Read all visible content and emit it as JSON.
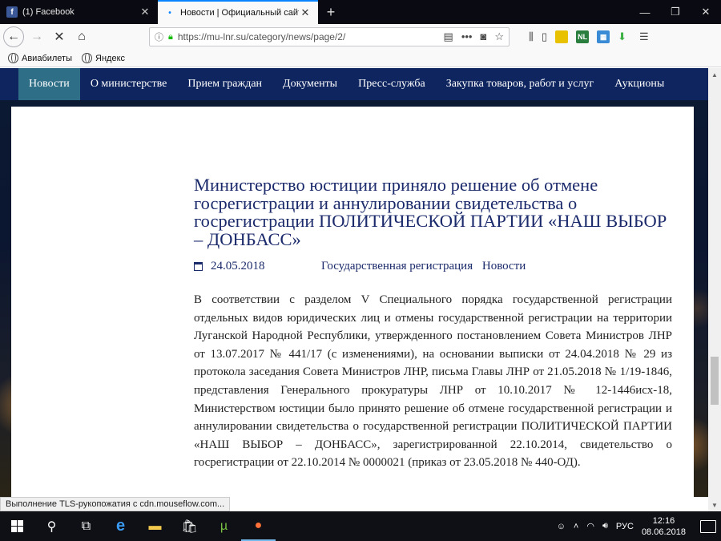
{
  "tabs": [
    {
      "favicon": "f",
      "favicon_name": "facebook-icon",
      "title": "(1) Facebook",
      "active": false
    },
    {
      "favicon": "•",
      "favicon_name": "loading-dot-icon",
      "title": "Новости | Официальный сайт",
      "active": true
    }
  ],
  "toolbar": {
    "url": "https://mu-lnr.su/category/news/page/2/"
  },
  "bookmarks": [
    "Авиабилеты",
    "Яндекс"
  ],
  "mainnav": [
    "Новости",
    "О министерстве",
    "Прием граждан",
    "Документы",
    "Пресс-служба",
    "Закупка товаров, работ и услуг",
    "Аукционы"
  ],
  "article": {
    "title": "Министерство юстиции приняло решение об отмене госрегистрации и аннулировании свидетельства о госрегистрации ПОЛИТИЧЕСКОЙ ПАРТИИ «НАШ ВЫБОР – ДОНБАСС»",
    "date": "24.05.2018",
    "categories": [
      "Государственная регистрация",
      "Новости"
    ],
    "body": "В соответствии с разделом V Специального порядка государственной регистрации отдельных видов юридических лиц и отмены государственной регистрации на территории Луганской Народной Республики, утвержденного постановлением Совета Министров ЛНР от 13.07.2017 № 441/17 (с изменениями), на основании выписки от 24.04.2018 № 29 из протокола заседания Совета Министров ЛНР, письма Главы ЛНР от 21.05.2018 № 1/19-1846, представления Генерального прокуратуры ЛНР от 10.10.2017 № 12-1446исх-18, Министерством юстиции было принято решение об отмене государственной регистрации и аннулировании свидетельства о государственной регистрации ПОЛИТИЧЕСКОЙ ПАРТИИ «НАШ ВЫБОР – ДОНБАСС», зарегистрированной 22.10.2014, свидетельство о госрегистрации от 22.10.2014 № 0000021 (приказ от 23.05.2018 № 440-ОД)."
  },
  "status_text": "Выполнение TLS-рукопожатия с cdn.mouseflow.com...",
  "tray": {
    "language": "РУС",
    "time": "12:16",
    "date": "08.06.2018"
  },
  "colors": {
    "nav_bg": "#0f2560",
    "nav_active": "#2e6f87",
    "heading": "#1b2a6b"
  }
}
